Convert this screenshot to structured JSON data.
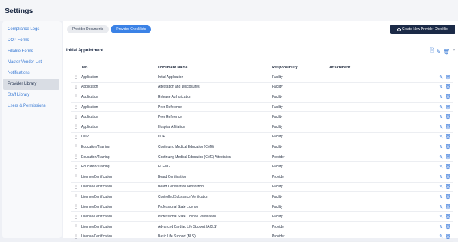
{
  "header": {
    "title": "Settings"
  },
  "sidebar": {
    "items": [
      {
        "label": "Compliance Logs"
      },
      {
        "label": "DOP Forms"
      },
      {
        "label": "Fillable Forms"
      },
      {
        "label": "Master Vendor List"
      },
      {
        "label": "Notifications"
      },
      {
        "label": "Provider Library",
        "active": true
      },
      {
        "label": "Staff Library"
      },
      {
        "label": "Users & Permissions"
      }
    ]
  },
  "main": {
    "tabs": [
      {
        "label": "Provider Documents"
      },
      {
        "label": "Provider Checklists",
        "active": true
      }
    ],
    "create_label": "Create New Provider Checklist",
    "section_title": "Initial Appointment",
    "columns": {
      "tab": "Tab",
      "doc": "Document Name",
      "resp": "Responsibility",
      "att": "Attachment"
    },
    "rows": [
      {
        "tab": "Application",
        "doc": "Initial Application",
        "resp": "Facility"
      },
      {
        "tab": "Application",
        "doc": "Attestation and Disclosures",
        "resp": "Facility"
      },
      {
        "tab": "Application",
        "doc": "Release Authorization",
        "resp": "Facility"
      },
      {
        "tab": "Application",
        "doc": "Peer Reference",
        "resp": "Facility"
      },
      {
        "tab": "Application",
        "doc": "Peer Reference",
        "resp": "Facility"
      },
      {
        "tab": "Application",
        "doc": "Hospital Affiliation",
        "resp": "Facility"
      },
      {
        "tab": "DOP",
        "doc": "DOP",
        "resp": "Facility"
      },
      {
        "tab": "Education/Training",
        "doc": "Continuing Medical Education (CME)",
        "resp": "Facility"
      },
      {
        "tab": "Education/Training",
        "doc": "Continuing Medical Education (CME) Attestation",
        "resp": "Provider"
      },
      {
        "tab": "Education/Training",
        "doc": "ECFMG",
        "resp": "Facility"
      },
      {
        "tab": "License/Certification",
        "doc": "Board Certification",
        "resp": "Provider"
      },
      {
        "tab": "License/Certification",
        "doc": "Board Certification Verification",
        "resp": "Facility"
      },
      {
        "tab": "License/Certification",
        "doc": "Controlled Substance Verification",
        "resp": "Facility"
      },
      {
        "tab": "License/Certification",
        "doc": "Professional State License",
        "resp": "Facility"
      },
      {
        "tab": "License/Certification",
        "doc": "Professional State License Verification",
        "resp": "Facility"
      },
      {
        "tab": "License/Certification",
        "doc": "Advanced Cardiac Life Support (ACLS)",
        "resp": "Provider"
      },
      {
        "tab": "License/Certification",
        "doc": "Basic Life Support (BLS)",
        "resp": "Provider"
      }
    ]
  }
}
